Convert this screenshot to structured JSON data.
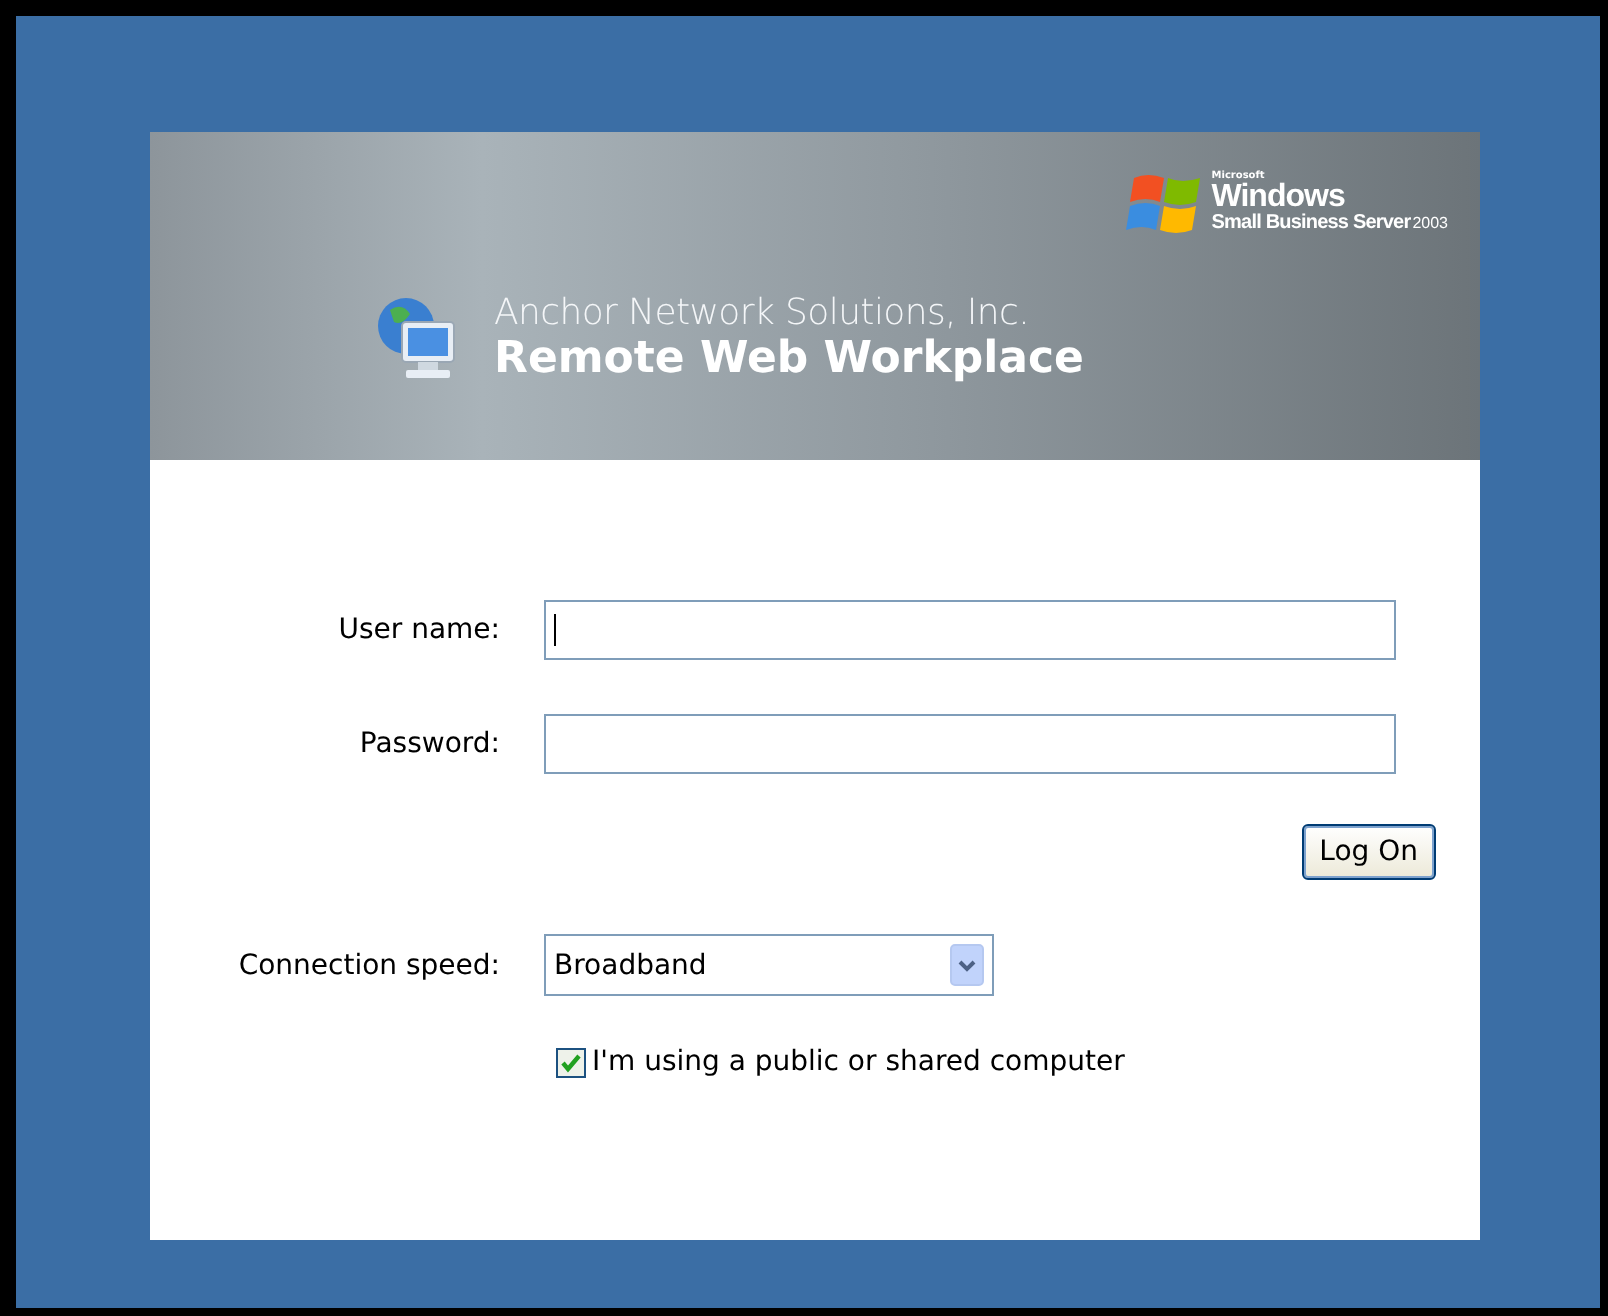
{
  "logo": {
    "maker": "Microsoft",
    "brand": "Windows",
    "product": "Small Business Server",
    "year": "2003"
  },
  "header": {
    "company": "Anchor Network Solutions, Inc.",
    "title": "Remote Web Workplace"
  },
  "fields": [
    {
      "label": "User name:",
      "focused": true
    },
    {
      "label": "Password:",
      "focused": false
    }
  ],
  "button": "Log On",
  "speed": {
    "label": "Connection speed:",
    "value": "Broadband"
  },
  "public_computer": {
    "label": "I'm using a public or shared computer",
    "checked": true
  }
}
